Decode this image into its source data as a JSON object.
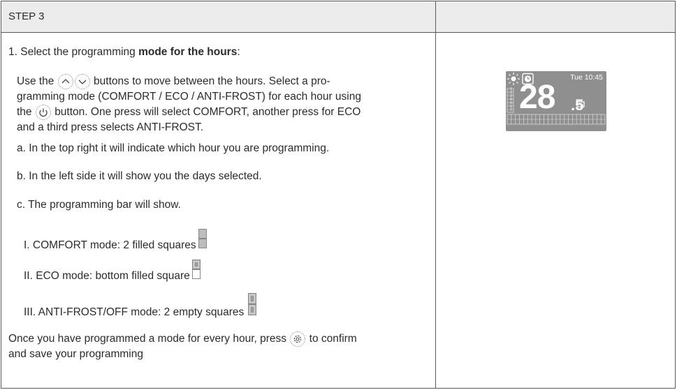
{
  "header": {
    "title": "STEP 3"
  },
  "step1": {
    "prefix": "1. Select the programming ",
    "bold": "mode for the hours",
    "suffix": ":"
  },
  "use": {
    "part1": "Use the",
    "part2": "buttons to move between the hours. Select a pro-",
    "line2": "gramming mode (COMFORT / ECO / ANTI-FROST) for each hour using",
    "line3a": "the",
    "line3b": "button. One press will select COMFORT, another press for ECO",
    "line4": "and a third press selects ANTI-FROST."
  },
  "items": {
    "a": "a. In the top right it will indicate which hour you are programming.",
    "b": "b. In the left side it will show you the days selected.",
    "c": "c. The programming bar will show.",
    "i": "I. COMFORT mode: 2 filled squares",
    "ii": "II. ECO mode: bottom filled square",
    "iii": "III. ANTI-FROST/OFF mode:  2 empty squares"
  },
  "confirm": {
    "line1a": "Once you have programmed a mode for every hour, press",
    "line1b": "to confirm",
    "line2": "and save your programming"
  },
  "display": {
    "time": "Tue 10:45",
    "temp": "28",
    "decimal": ".5",
    "days": [
      "1",
      "2",
      "3",
      "4",
      "5",
      "6",
      "7"
    ]
  },
  "icons": [
    "up-arrow-icon",
    "down-arrow-icon",
    "power-icon",
    "settings-gear-icon",
    "sun-icon",
    "clock-icon"
  ]
}
